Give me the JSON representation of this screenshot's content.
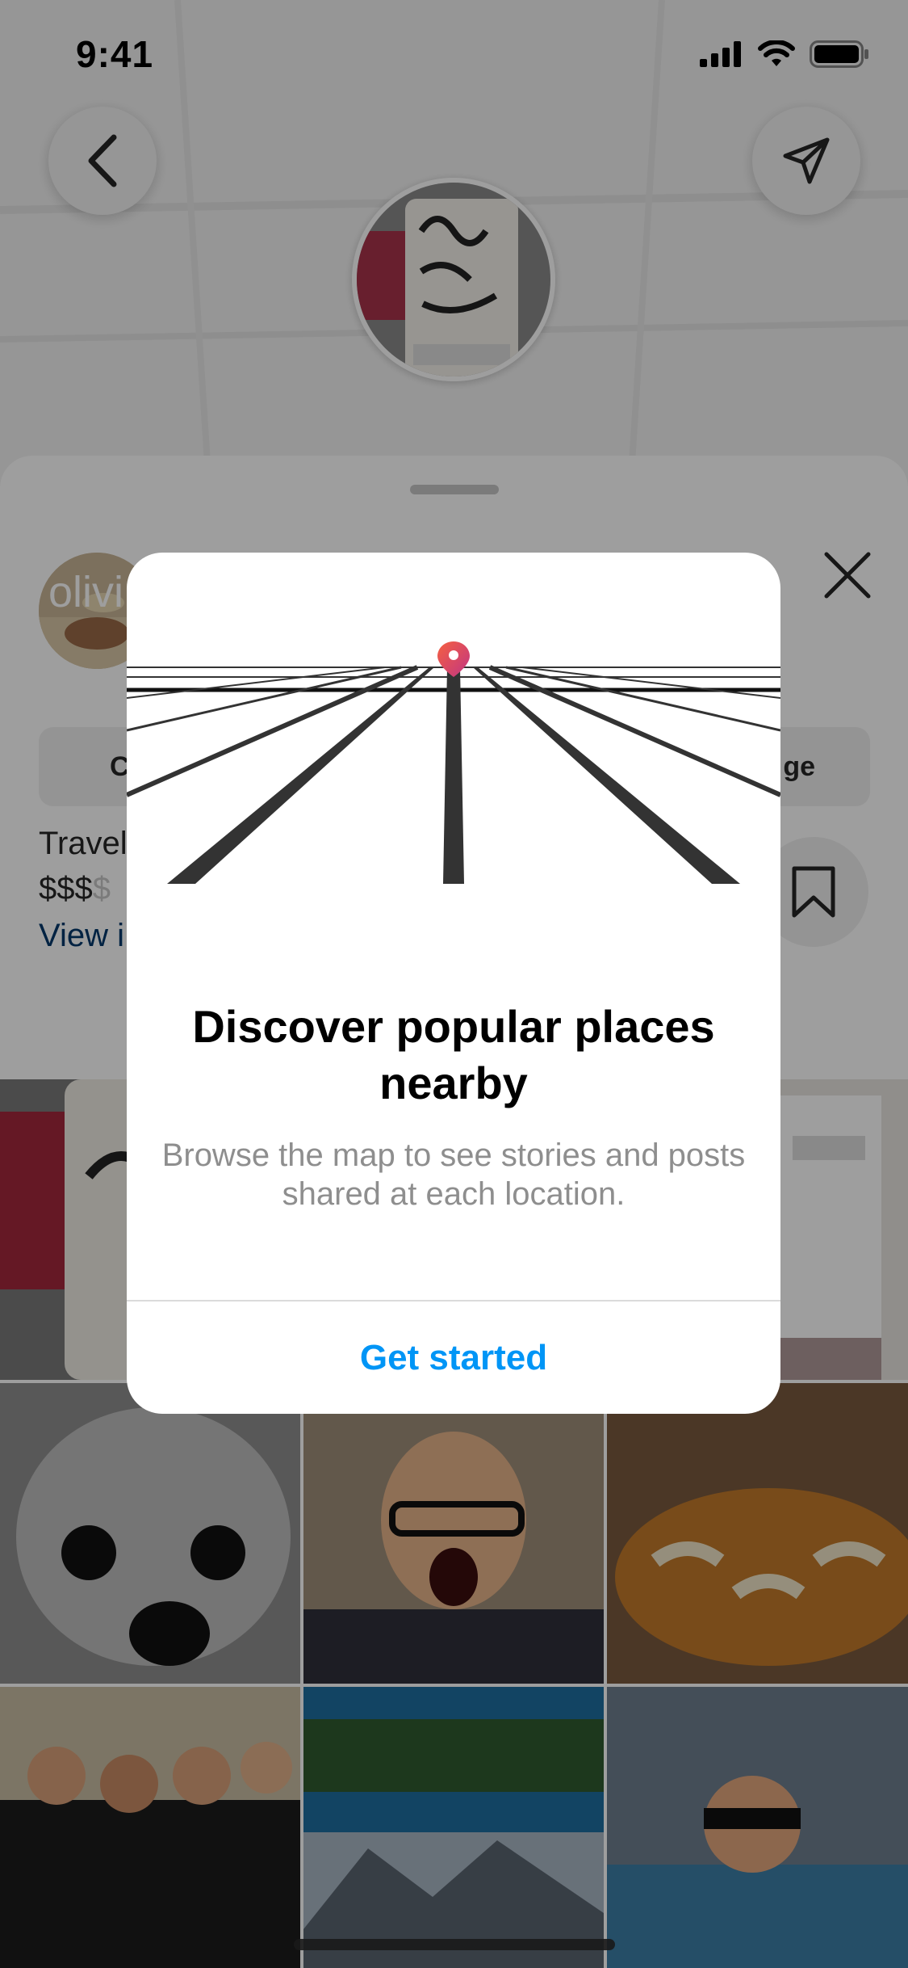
{
  "status_bar": {
    "time": "9:41"
  },
  "top_bar": {
    "back_icon": "chevron-left-icon",
    "share_icon": "paper-plane-icon"
  },
  "sheet": {
    "profile_name_partial": "olivi",
    "button_left_partial": "C",
    "button_right_partial": "ge",
    "category_partial": "Travel",
    "price_active": "$$$",
    "price_dim": "$",
    "link_partial": "View i"
  },
  "modal": {
    "title": "Discover popular places nearby",
    "body": "Browse the map to see stories and posts shared at each location.",
    "cta": "Get started"
  },
  "colors": {
    "accent_blue": "#0095f6",
    "link_blue": "#00376b",
    "pin_start": "#f56040",
    "pin_end": "#c13584"
  }
}
